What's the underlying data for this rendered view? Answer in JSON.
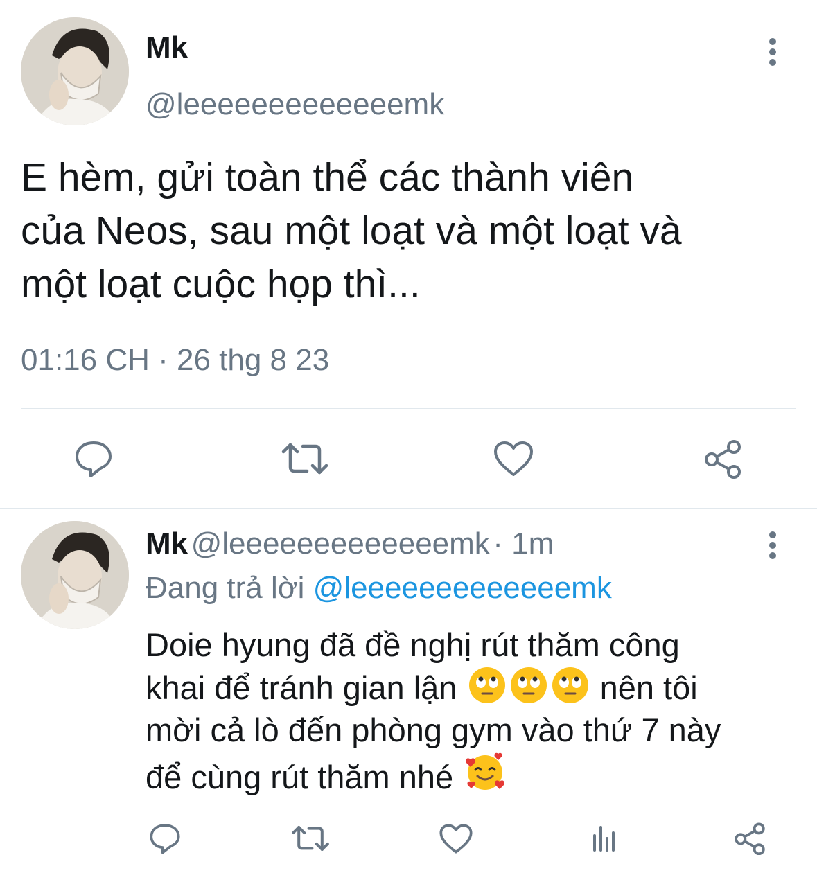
{
  "main_tweet": {
    "display_name": "Mk",
    "handle": "@leeeeeeeeeeeeemk",
    "text_line1": "E hèm, gửi toàn thể các thành viên",
    "text_line2": "của Neos, sau một loạt và một loạt và",
    "text_line3": "một loạt cuộc họp thì...",
    "timestamp": "01:16 CH · 26 thg 8 23",
    "actions": [
      "reply-icon",
      "retweet-icon",
      "like-icon",
      "share-icon"
    ]
  },
  "reply_tweet": {
    "display_name": "Mk",
    "handle": "@leeeeeeeeeeeeemk",
    "time_ago": "· 1m",
    "replying_prefix": "Đang trả lời",
    "replying_to": "@leeeeeeeeeeeeemk",
    "line1": "Doie hyung đã đề nghị rút thăm công",
    "line2_start": "khai để tránh gian lận",
    "line2_end": "nên tôi",
    "line3": "mời cả lò đến phòng gym vào thứ 7 này",
    "line4": "để cùng rút thăm nhé",
    "emojis": [
      "face-with-rolling-eyes",
      "face-with-rolling-eyes",
      "face-with-rolling-eyes",
      "smiling-face-with-hearts"
    ],
    "actions": [
      "reply-icon",
      "retweet-icon",
      "like-icon",
      "analytics-icon",
      "share-icon"
    ]
  },
  "colors": {
    "text": "#14171a",
    "secondary": "#687684",
    "link": "#1b95e0",
    "divider": "#e1e8ed",
    "icon": "#687684"
  }
}
